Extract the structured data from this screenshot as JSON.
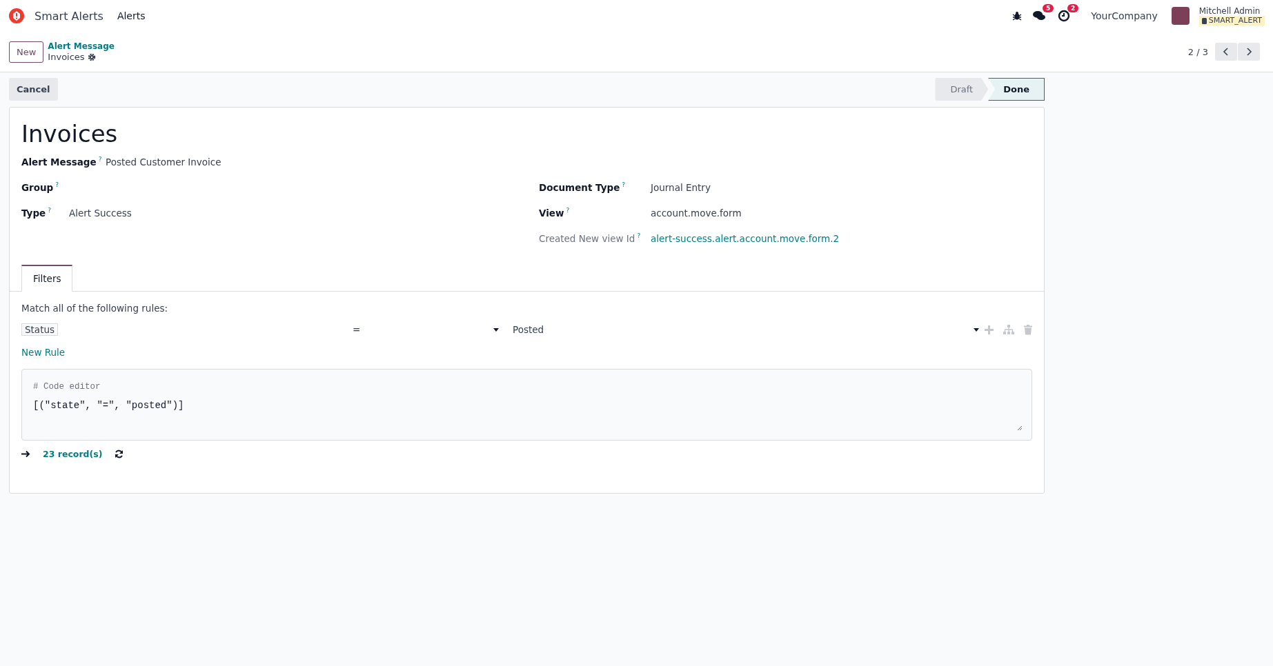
{
  "navbar": {
    "app_name": "Smart Alerts",
    "menu": [
      {
        "label": "Alerts"
      }
    ],
    "chat_count": "5",
    "activity_count": "2",
    "company": "YourCompany",
    "user": {
      "name": "Mitchell Admin",
      "database": "SMART_ALERT"
    }
  },
  "control_panel": {
    "new_button": "New",
    "breadcrumb": "Alert Message",
    "record_title": "Invoices",
    "pager": "2 / 3"
  },
  "actions": [
    {
      "label": "Cancel"
    }
  ],
  "status_bar": [
    {
      "label": "Draft",
      "selected": false
    },
    {
      "label": "Done",
      "selected": true
    }
  ],
  "form": {
    "title": "Invoices",
    "top_fields": [
      {
        "label": "Alert Message",
        "help": "?",
        "value": "Posted Customer Invoice"
      }
    ],
    "left_fields": [
      {
        "label": "Group",
        "help": "?"
      },
      {
        "label": "Type",
        "help": "?",
        "value": "Alert Success"
      }
    ],
    "right_fields": [
      {
        "label": "Document Type",
        "help": "?",
        "value": "Journal Entry",
        "kind": "text",
        "readonly": false
      },
      {
        "label": "View",
        "help": "?",
        "value": "account.move.form",
        "kind": "text",
        "readonly": false
      },
      {
        "label": "Created New view Id",
        "help": "?",
        "value": "alert-success.alert.account.move.form.2",
        "kind": "link",
        "readonly": true
      }
    ],
    "tabs": [
      {
        "label": "Filters",
        "selected": true
      }
    ],
    "filter": {
      "intro": "Match all of the following rules:",
      "rules": [
        {
          "field": "Status",
          "operator": "=",
          "value": "Posted"
        }
      ],
      "new_rule": "New Rule",
      "code_label": "# Code editor",
      "code": "[(\"state\", \"=\", \"posted\")]",
      "record_count": "23 record(s)"
    }
  }
}
